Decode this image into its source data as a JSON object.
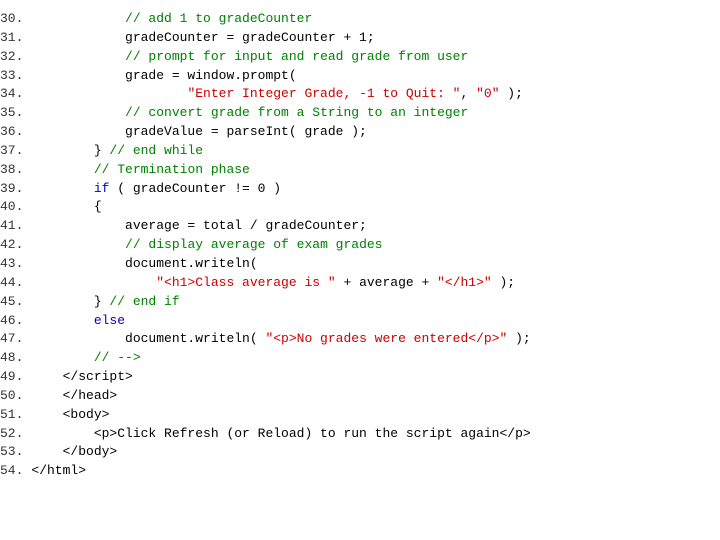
{
  "lines": [
    {
      "num": "30.",
      "html": "<span class='kw-black'>            </span><span class='kw-green'>// add 1 to gradeCounter</span>"
    },
    {
      "num": "31.",
      "html": "<span class='kw-black'>            gradeCounter = gradeCounter + 1;</span>"
    },
    {
      "num": "32.",
      "html": "<span class='kw-black'>            </span><span class='kw-green'>// prompt for input and read grade from user</span>"
    },
    {
      "num": "33.",
      "html": "<span class='kw-black'>            grade = window.prompt(</span>"
    },
    {
      "num": "34.",
      "html": "<span class='kw-black'>                    </span><span class='kw-red'>\"Enter Integer Grade, -1 to Quit: \"</span><span class='kw-black'>, </span><span class='kw-red'>\"0\"</span><span class='kw-black'> );</span>"
    },
    {
      "num": "35.",
      "html": "<span class='kw-black'>            </span><span class='kw-green'>// convert grade from a String to an integer</span>"
    },
    {
      "num": "36.",
      "html": "<span class='kw-black'>            gradeValue = parseInt( grade );</span>"
    },
    {
      "num": "37.",
      "html": "<span class='kw-black'>        } </span><span class='kw-green'>// end while</span>"
    },
    {
      "num": "38.",
      "html": "<span class='kw-black'>        </span><span class='kw-green'>// Termination phase</span>"
    },
    {
      "num": "39.",
      "html": "<span class='kw-black'>        </span><span class='kw-blue'>if</span><span class='kw-black'> ( gradeCounter != 0 )</span>"
    },
    {
      "num": "40.",
      "html": "<span class='kw-black'>        {</span>"
    },
    {
      "num": "41.",
      "html": "<span class='kw-black'>            average = total / gradeCounter;</span>"
    },
    {
      "num": "42.",
      "html": "<span class='kw-black'>            </span><span class='kw-green'>// display average of exam grades</span>"
    },
    {
      "num": "43.",
      "html": "<span class='kw-black'>            document.writeln(</span>"
    },
    {
      "num": "44.",
      "html": "<span class='kw-black'>                </span><span class='kw-red'>\"&lt;h1&gt;Class average is \"</span><span class='kw-black'> + average + </span><span class='kw-red'>\"&lt;/h1&gt;\"</span><span class='kw-black'> );</span>"
    },
    {
      "num": "45.",
      "html": "<span class='kw-black'>        } </span><span class='kw-green'>// end if</span>"
    },
    {
      "num": "46.",
      "html": "<span class='kw-black'>        </span><span class='kw-blue'>else</span>"
    },
    {
      "num": "47.",
      "html": "<span class='kw-black'>            document.writeln( </span><span class='kw-red'>\"&lt;p&gt;No grades were entered&lt;/p&gt;\"</span><span class='kw-black'> );</span>"
    },
    {
      "num": "48.",
      "html": "<span class='kw-black'>        </span><span class='kw-green'>// --&gt;</span>"
    },
    {
      "num": "49.",
      "html": "<span class='kw-black'>    &lt;/script&gt;</span>"
    },
    {
      "num": "50.",
      "html": "<span class='kw-black'>    &lt;/head&gt;</span>"
    },
    {
      "num": "51.",
      "html": "<span class='kw-black'>    &lt;body&gt;</span>"
    },
    {
      "num": "52.",
      "html": "<span class='kw-black'>        &lt;p&gt;Click Refresh (or Reload) to run the script again&lt;/p&gt;</span>"
    },
    {
      "num": "53.",
      "html": "<span class='kw-black'>    &lt;/body&gt;</span>"
    },
    {
      "num": "54.",
      "html": "<span class='kw-black'>&lt;/html&gt;</span>"
    }
  ]
}
